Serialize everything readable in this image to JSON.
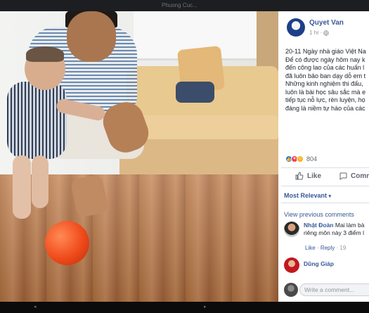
{
  "window": {
    "background": "#0b0b0b",
    "accent": "#385898"
  },
  "topbar": {
    "tab_left": "",
    "tab_right": "Phuong Cuc..."
  },
  "photo": {
    "description_icon": "photo"
  },
  "post": {
    "author": "Quyet Van",
    "time": "1 hr",
    "privacy_icon": "globe-icon",
    "lines": [
      "20-11 Ngày nhà giáo Việt Na",
      "Để có được ngày hôm nay k",
      "đến công lao của các huấn l",
      "đã luôn bảo ban dạy dỗ em t",
      "Những kinh nghiệm thi đấu,",
      "luôn là bài học sâu sắc mà e",
      "tiếp tục nỗ lực, rèn luyện, họ",
      "đáng là niềm tự hào của các"
    ]
  },
  "reactions": {
    "count": "804",
    "icons": [
      "like-reaction-icon",
      "love-reaction-icon",
      "haha-reaction-icon"
    ]
  },
  "actions": {
    "like": "Like",
    "comment": "Comm"
  },
  "comments_section": {
    "sort_label": "Most Relevant",
    "view_previous": "View previous comments",
    "comments": [
      {
        "author": "Nhật Đoàn",
        "text_line1": "Mai làm bà",
        "text_line2": "riêng môn này 3 điểm l",
        "like": "Like",
        "reply": "Reply",
        "age": "19"
      },
      {
        "author": "Dũng Giáp",
        "text_line1": "",
        "text_line2": "",
        "like": "",
        "reply": "",
        "age": ""
      }
    ],
    "write_placeholder": "Write a comment..."
  }
}
